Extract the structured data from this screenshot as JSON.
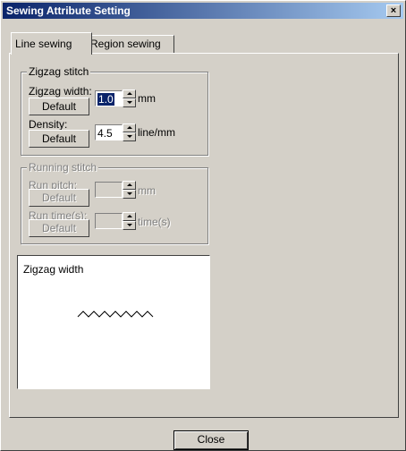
{
  "window": {
    "title": "Sewing Attribute Setting",
    "close_glyph": "×"
  },
  "tabs": [
    {
      "label": "Line sewing",
      "active": true
    },
    {
      "label": "Region sewing",
      "active": false
    }
  ],
  "zigzag": {
    "legend": "Zigzag stitch",
    "width_label": "Zigzag width:",
    "width_value": "1.0",
    "width_unit": "mm",
    "density_label": "Density:",
    "density_value": "4.5",
    "density_unit": "line/mm",
    "default_label": "Default"
  },
  "running": {
    "legend": "Running stitch",
    "pitch_label": "Run pitch:",
    "pitch_unit": "mm",
    "times_label": "Run time(s):",
    "times_unit": "time(s)",
    "default_label": "Default",
    "enabled": false
  },
  "preview": {
    "caption": "Zigzag width"
  },
  "footer": {
    "close_label": "Close"
  }
}
